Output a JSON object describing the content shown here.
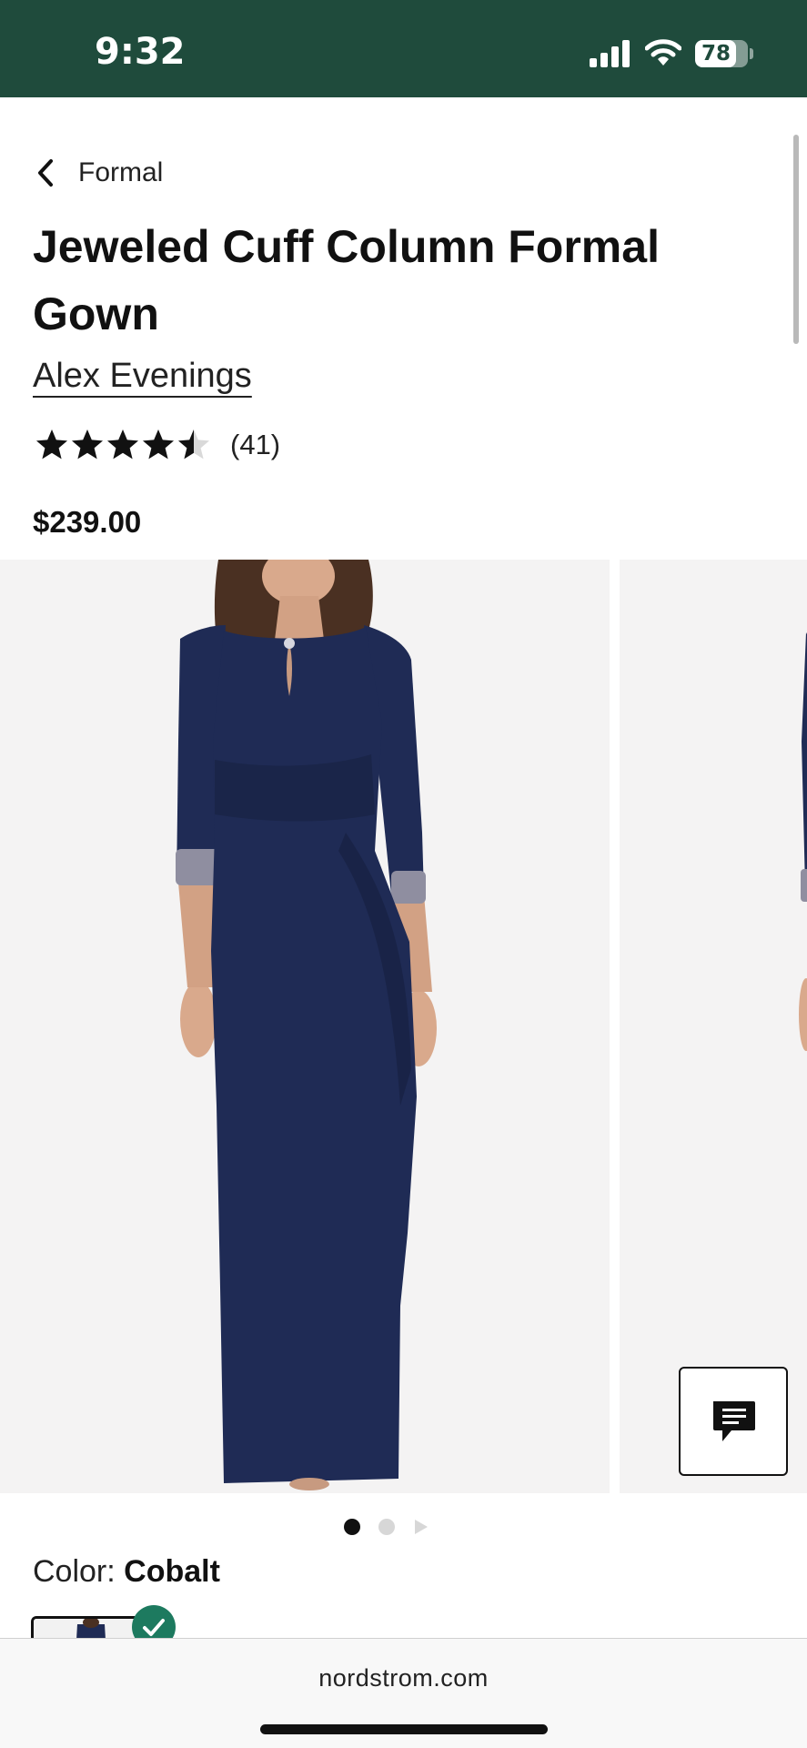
{
  "status_bar": {
    "time": "9:32",
    "battery_level": "78",
    "icons": [
      "signal-bars-icon",
      "wifi-icon",
      "battery-icon"
    ]
  },
  "breadcrumb": {
    "back_label": "Formal",
    "icon": "chevron-left-icon"
  },
  "product": {
    "title": "Jeweled Cuff Column Formal Gown",
    "brand": "Alex Evenings",
    "rating": 4.5,
    "rating_max": 5,
    "review_count": "(41)",
    "price": "$239.00"
  },
  "gallery": {
    "current_slide": 1,
    "slide_count": 3,
    "dress_color": "#1f2b55"
  },
  "color_selector": {
    "label": "Color:",
    "selected": "Cobalt",
    "selected_icon": "checkmark-icon"
  },
  "chat": {
    "icon": "chat-bubble-icon"
  },
  "browser": {
    "url": "nordstrom.com"
  },
  "colors": {
    "status_bar_bg": "#1f4b3c",
    "accent_green": "#1d7a5f",
    "text": "#111111"
  }
}
